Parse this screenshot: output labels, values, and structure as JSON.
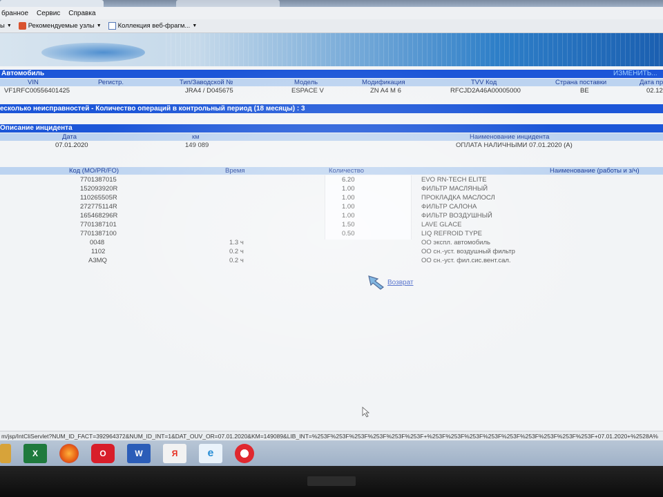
{
  "menu": [
    "бранное",
    "Сервис",
    "Справка"
  ],
  "favorites": {
    "left_label": "ы",
    "item1": "Рекомендуемые узлы",
    "item2": "Коллекция веб-фрагм..."
  },
  "vehicle": {
    "section_title": "Автомобиль",
    "right_label": "ИЗМЕНИТЬ...",
    "headers": {
      "vin": "VIN",
      "reg": "Регистр.",
      "type": "Тип/Заводской №",
      "model": "Модель",
      "mod": "Модификация",
      "tvv": "TVV Код",
      "country": "Страна поставки",
      "date": "Дата пр"
    },
    "row": {
      "vin": "VF1RFC00556401425",
      "reg": "",
      "type": "JRA4 / D045675",
      "model": "ESPACE V",
      "mod": "ZN A4 M 6",
      "tvv": "RFCJD2A46A00005000",
      "country": "BE",
      "date": "02.12"
    }
  },
  "faults_bar": "есколько неисправностей - Количество операций в контрольный период (18 месяцы) : 3",
  "incident": {
    "section_title": "Описание инцидента",
    "headers": {
      "date": "Дата",
      "km": "км",
      "name": "Наименование инцидента"
    },
    "row": {
      "date": "07.01.2020",
      "km": "149 089",
      "name": "ОПЛАТА НАЛИЧНЫМИ 07.01.2020 (A)"
    }
  },
  "lines": {
    "headers": {
      "code": "Код (MO/PR/FO)",
      "time": "Время",
      "qty": "Количество",
      "name": "Наименование (работы и з/ч)"
    },
    "rows": [
      {
        "code": "7701387015",
        "time": "",
        "qty": "6.20",
        "name": "EVO RN-TECH ELITE"
      },
      {
        "code": "152093920R",
        "time": "",
        "qty": "1.00",
        "name": "ФИЛЬТР МАСЛЯНЫЙ"
      },
      {
        "code": "110265505R",
        "time": "",
        "qty": "1.00",
        "name": "ПРОКЛАДКА МАСЛОСЛ"
      },
      {
        "code": "272775114R",
        "time": "",
        "qty": "1.00",
        "name": "ФИЛЬТР САЛОНА"
      },
      {
        "code": "165468296R",
        "time": "",
        "qty": "1.00",
        "name": "ФИЛЬТР ВОЗДУШНЫЙ"
      },
      {
        "code": "7701387101",
        "time": "",
        "qty": "1.50",
        "name": "LAVE GLACE"
      },
      {
        "code": "7701387100",
        "time": "",
        "qty": "0.50",
        "name": "LIQ REFROID TYPE"
      },
      {
        "code": "0048",
        "time": "1.3 ч",
        "qty": "",
        "name": "ОО экспл. автомобиль"
      },
      {
        "code": "1102",
        "time": "0.2 ч",
        "qty": "",
        "name": "ОО сн.-уст. воздушный фильтр"
      },
      {
        "code": "A3MQ",
        "time": "0.2 ч",
        "qty": "",
        "name": "ОО сн.-уст. фил.сис.вент.сал."
      }
    ]
  },
  "back_link": "Возврат",
  "status_url": "m/jsp/IntCliServlet?NUM_ID_FACT=392964372&NUM_ID_INT=1&DAT_OUV_OR=07.01.2020&KM=149089&LIB_INT=%253F%253F%253F%253F%253F%253F+%253F%253F%253F%253F%253F%253F%253F%253F%253F+07.01.2020+%2528A%"
}
